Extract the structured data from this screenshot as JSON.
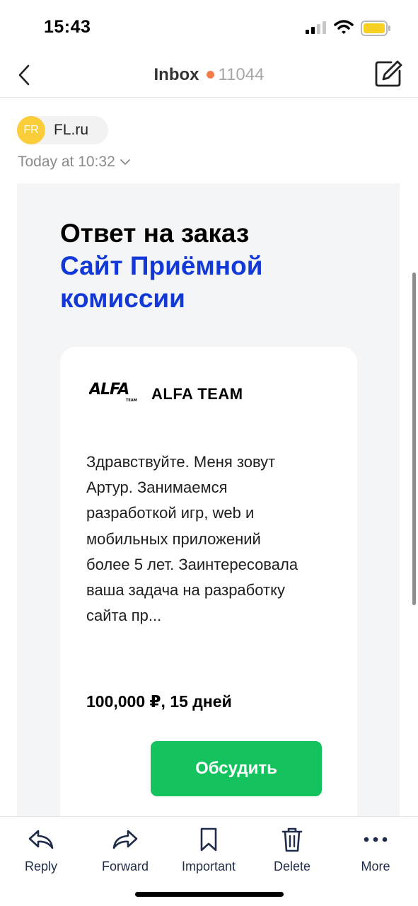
{
  "status_bar": {
    "time": "15:43"
  },
  "nav": {
    "title": "Inbox",
    "unread_count": "11044"
  },
  "sender": {
    "initials": "FR",
    "name": "FL.ru",
    "avatar_color": "#f9ce3a"
  },
  "date": "Today at 10:32",
  "email": {
    "heading_line1": "Ответ на заказ",
    "heading_project": "Сайт Приёмной комиссии",
    "card": {
      "logo_text": "ALFA",
      "logo_subtext": "TEAM",
      "company": "ALFA TEAM",
      "message": "Здравствуйте. Меня зовут Артур. Занимаемся разработкой игр, web и мобильных приложений более 5 лет. Заинтересовала ваша задача на разработку сайта пр...",
      "price": "100,000 ₽, 15 дней",
      "button_label": "Обсудить",
      "button_color": "#14c35d"
    }
  },
  "toolbar": {
    "reply": "Reply",
    "forward": "Forward",
    "important": "Important",
    "delete": "Delete",
    "more": "More"
  },
  "colors": {
    "accent_blue": "#1239d7",
    "unread_dot": "#f47b4a",
    "icon_navy": "#1f2d4a"
  }
}
